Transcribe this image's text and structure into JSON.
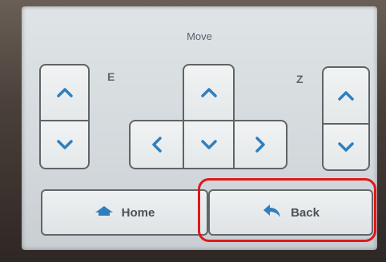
{
  "screen": {
    "title": "Move"
  },
  "axes": {
    "e_label": "E",
    "z_label": "Z"
  },
  "buttons": {
    "home_label": "Home",
    "back_label": "Back"
  },
  "icons": {
    "up": "chevron-up-icon",
    "down": "chevron-down-icon",
    "left": "chevron-left-icon",
    "right": "chevron-right-icon",
    "home": "home-icon",
    "back": "back-arrow-icon"
  },
  "colors": {
    "icon_blue": "#2f7fbf",
    "highlight_red": "#e01818"
  }
}
